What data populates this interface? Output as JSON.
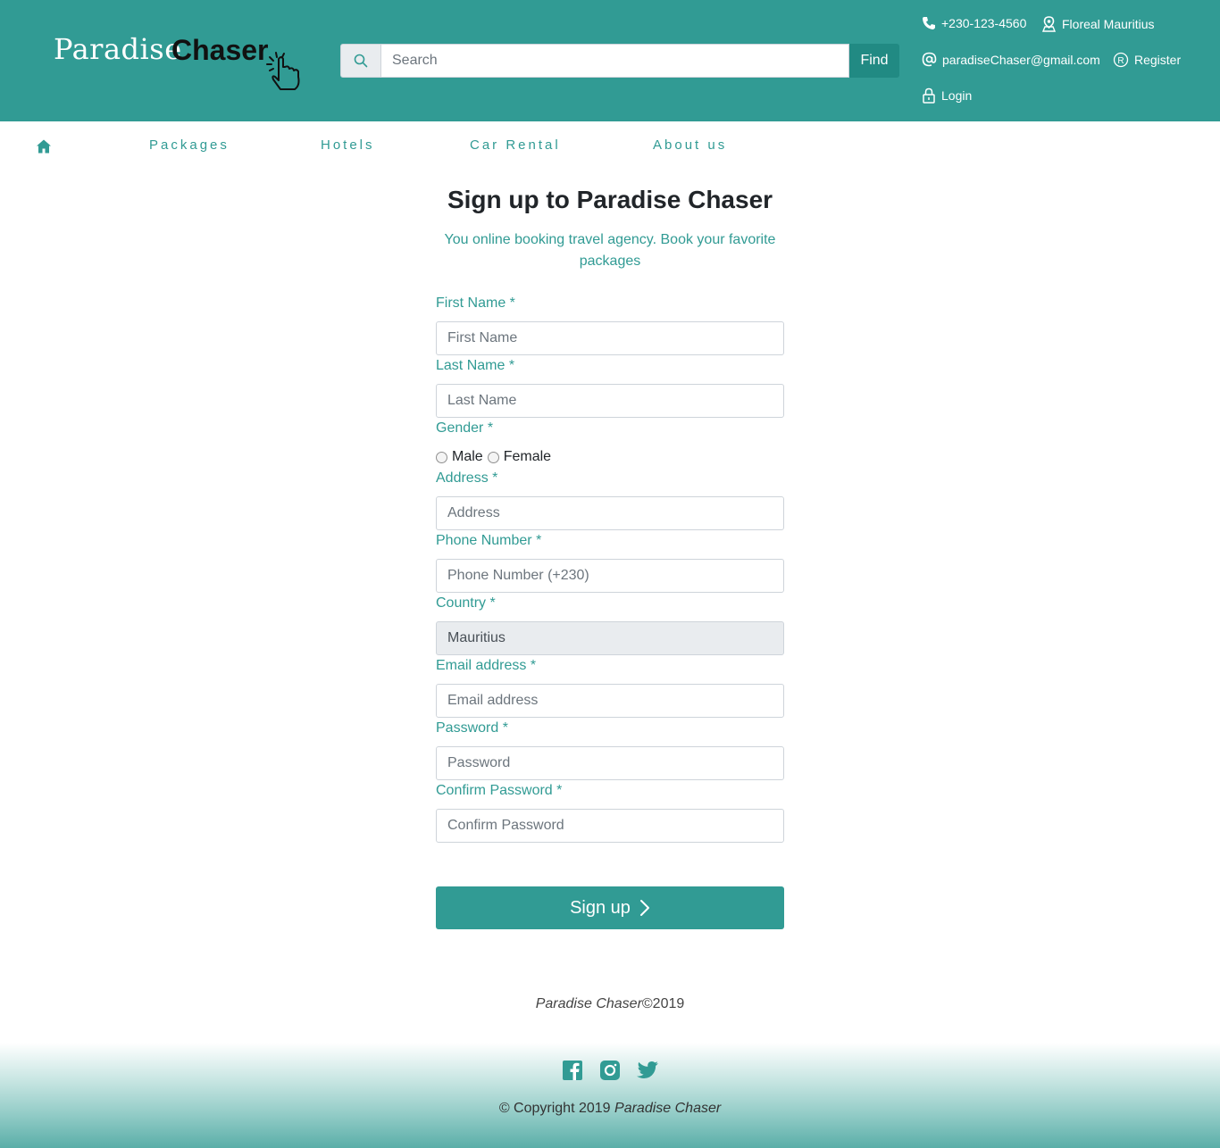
{
  "header": {
    "logo_light": "Paradise",
    "logo_bold": "Chaser",
    "search": {
      "placeholder": "Search",
      "button_label": "Find"
    },
    "contact": {
      "phone": "+230-123-4560",
      "location": "Floreal Mauritius",
      "email": "paradiseChaser@gmail.com",
      "register": "Register",
      "login": "Login"
    }
  },
  "nav": {
    "items": [
      {
        "label": "Packages"
      },
      {
        "label": "Hotels"
      },
      {
        "label": "Car Rental"
      },
      {
        "label": "About us"
      }
    ]
  },
  "form": {
    "title": "Sign up to Paradise Chaser",
    "subtitle": "You online booking travel agency. Book your favorite packages",
    "fields": {
      "first_name": {
        "label": "First Name *",
        "placeholder": "First Name"
      },
      "last_name": {
        "label": "Last Name *",
        "placeholder": "Last Name"
      },
      "gender": {
        "label": "Gender *",
        "options": [
          "Male",
          "Female"
        ]
      },
      "address": {
        "label": "Address *",
        "placeholder": "Address"
      },
      "phone": {
        "label": "Phone Number *",
        "placeholder": "Phone Number (+230)"
      },
      "country": {
        "label": "Country *",
        "value": "Mauritius"
      },
      "email": {
        "label": "Email address *",
        "placeholder": "Email address"
      },
      "password": {
        "label": "Password *",
        "placeholder": "Password"
      },
      "confirm_password": {
        "label": "Confirm Password *",
        "placeholder": "Confirm Password"
      }
    },
    "submit_label": "Sign up"
  },
  "brand_line": {
    "name": "Paradise Chaser",
    "year": "©2019"
  },
  "footer": {
    "copyright_prefix": "© Copyright 2019",
    "copyright_brand": "Paradise Chaser",
    "social": [
      "facebook-icon",
      "instagram-icon",
      "twitter-icon"
    ]
  },
  "colors": {
    "primary": "#319b94",
    "primary_dark": "#218a83"
  }
}
